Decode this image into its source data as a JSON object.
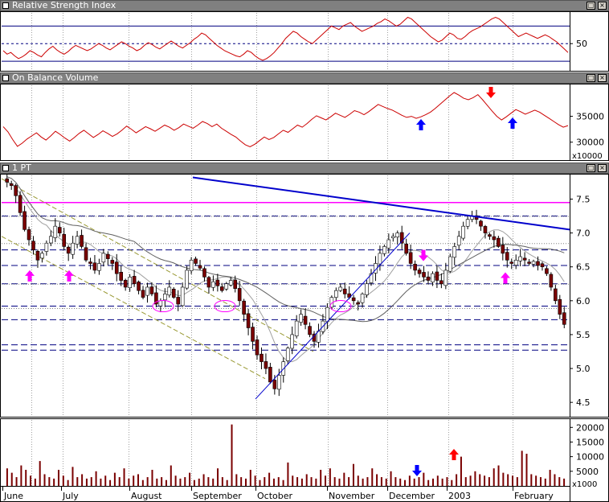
{
  "panes": {
    "rsi": {
      "title": "Relative Strength Index",
      "scale_label": ""
    },
    "obv": {
      "title": "On Balance Volume",
      "scale_label": "x10000"
    },
    "price": {
      "title": "1 PT"
    },
    "volume": {
      "title": "",
      "scale_label": "x1000"
    }
  },
  "window_buttons": {
    "restore": "□",
    "close": "×"
  },
  "colors": {
    "rsi_line": "#cc0000",
    "obv_line": "#cc0000",
    "candle_up": "#ffffff",
    "candle_down": "#7a0000",
    "trendline": "#0000cc",
    "horizontal_line": "#ff00ff",
    "fib_lines": "#000080",
    "channel": "#999933",
    "moving_average": "#808080",
    "volume_bar": "#7a0000",
    "arrow_up_blue": "#0000ff",
    "arrow_down_red": "#ff0000",
    "arrow_magenta": "#ff00ff"
  },
  "chart_data": [
    {
      "id": "rsi",
      "type": "line",
      "title": "Relative Strength Index",
      "y_tick_labels": [
        "50"
      ],
      "reference_lines": [
        30,
        50,
        70
      ],
      "series": [
        {
          "values": [
            42,
            38,
            40,
            36,
            33,
            35,
            38,
            42,
            40,
            37,
            35,
            40,
            44,
            47,
            43,
            40,
            38,
            41,
            45,
            48,
            46,
            44,
            42,
            44,
            47,
            50,
            48,
            45,
            43,
            46,
            49,
            52,
            50,
            47,
            45,
            42,
            44,
            48,
            51,
            49,
            46,
            44,
            47,
            50,
            53,
            50,
            47,
            45,
            48,
            51,
            55,
            58,
            62,
            60,
            56,
            52,
            48,
            45,
            42,
            40,
            38,
            36,
            35,
            38,
            42,
            40,
            36,
            33,
            31,
            33,
            36,
            40,
            45,
            50,
            56,
            60,
            64,
            62,
            58,
            55,
            52,
            50,
            54,
            58,
            62,
            66,
            70,
            68,
            66,
            70,
            72,
            74,
            70,
            67,
            64,
            66,
            68,
            70,
            73,
            75,
            78,
            76,
            73,
            70,
            72,
            76,
            80,
            78,
            74,
            70,
            66,
            62,
            58,
            55,
            52,
            54,
            58,
            62,
            60,
            56,
            55,
            58,
            62,
            65,
            67,
            69,
            72,
            75,
            78,
            80,
            78,
            74,
            70,
            66,
            62,
            58,
            60,
            62,
            60,
            58,
            56,
            58,
            60,
            58,
            55,
            52,
            48,
            44,
            40
          ]
        }
      ]
    },
    {
      "id": "obv",
      "type": "line",
      "title": "On Balance Volume",
      "y_tick_labels": [
        "35000",
        "30000"
      ],
      "ylim": [
        27000,
        41000
      ],
      "series": [
        {
          "values": [
            33000,
            32000,
            30500,
            29200,
            29800,
            30600,
            31200,
            31800,
            31000,
            30400,
            31200,
            32100,
            31500,
            30800,
            30200,
            30900,
            31700,
            32300,
            31600,
            30900,
            31500,
            32200,
            31700,
            31100,
            31600,
            32300,
            33100,
            32500,
            31800,
            32400,
            33000,
            32600,
            32100,
            32700,
            33300,
            32900,
            32300,
            32800,
            33500,
            33100,
            32700,
            33300,
            34000,
            33600,
            33000,
            33500,
            32700,
            32100,
            31500,
            31000,
            30200,
            29500,
            29100,
            29600,
            30300,
            31000,
            30500,
            30900,
            31600,
            32300,
            31900,
            32600,
            33300,
            32900,
            33600,
            34400,
            35100,
            34700,
            34300,
            34900,
            35600,
            35200,
            34800,
            35400,
            36100,
            35800,
            35300,
            35900,
            36600,
            37300,
            36900,
            36500,
            36200,
            35700,
            35200,
            34800,
            35000,
            34600,
            34900,
            35300,
            35800,
            36500,
            37300,
            38100,
            38900,
            39600,
            39100,
            38500,
            38200,
            38600,
            39200,
            38200,
            37100,
            36000,
            35000,
            34300,
            34900,
            35600,
            36300,
            35900,
            35400,
            35800,
            36200,
            35800,
            35200,
            34600,
            34000,
            33400,
            32900,
            33200
          ]
        }
      ],
      "annotations": [
        "blue up arrow (Dec)",
        "red down arrow (Jan)",
        "blue up arrow (Jan/Feb)"
      ]
    },
    {
      "id": "price",
      "type": "candlestick",
      "title": "1 PT",
      "y_tick_labels": [
        "7.5",
        "7.0",
        "6.5",
        "6.0",
        "5.5",
        "5.0",
        "4.5"
      ],
      "ylim": [
        4.3,
        7.85
      ],
      "x_tick_labels": [
        "June",
        "July",
        "August",
        "September",
        "October",
        "November",
        "December",
        "2003",
        "February"
      ],
      "horizontal_levels": {
        "magenta": [
          7.45
        ],
        "dashed": [
          7.25,
          6.75,
          6.52,
          6.25,
          5.92,
          5.72,
          5.35,
          5.27
        ],
        "dotted": [
          7.28,
          6.88,
          6.28,
          5.92
        ]
      },
      "closes": [
        7.75,
        7.7,
        7.55,
        7.3,
        7.05,
        6.9,
        6.75,
        6.6,
        6.7,
        6.85,
        6.95,
        7.1,
        7.0,
        6.8,
        6.7,
        6.85,
        6.95,
        6.8,
        6.6,
        6.55,
        6.45,
        6.55,
        6.7,
        6.62,
        6.55,
        6.4,
        6.3,
        6.2,
        6.35,
        6.25,
        6.15,
        6.05,
        6.2,
        6.1,
        5.95,
        6.0,
        6.1,
        6.2,
        6.05,
        5.95,
        6.2,
        6.45,
        6.6,
        6.55,
        6.48,
        6.35,
        6.2,
        6.28,
        6.22,
        6.15,
        6.25,
        6.3,
        6.18,
        6.0,
        5.8,
        5.6,
        5.4,
        5.2,
        5.1,
        5.0,
        4.8,
        4.7,
        4.9,
        5.1,
        5.3,
        5.5,
        5.7,
        5.8,
        5.65,
        5.5,
        5.4,
        5.55,
        5.7,
        5.9,
        6.05,
        6.15,
        6.2,
        6.1,
        6.05,
        6.0,
        5.95,
        6.1,
        6.25,
        6.4,
        6.55,
        6.7,
        6.8,
        6.9,
        6.95,
        7.0,
        6.85,
        6.7,
        6.55,
        6.45,
        6.4,
        6.35,
        6.3,
        6.4,
        6.3,
        6.25,
        6.45,
        6.65,
        6.8,
        6.95,
        7.1,
        7.2,
        7.25,
        7.2,
        7.1,
        7.0,
        6.95,
        6.9,
        6.8,
        6.7,
        6.6,
        6.55,
        6.6,
        6.65,
        6.6,
        6.55,
        6.58,
        6.52,
        6.5,
        6.4,
        6.2,
        6.0,
        5.8,
        5.65
      ]
    },
    {
      "id": "volume",
      "type": "bar",
      "y_tick_labels": [
        "20000",
        "15000",
        "10000",
        "5000"
      ],
      "ylim": [
        0,
        22000
      ],
      "values": [
        6000,
        4500,
        3000,
        7000,
        5500,
        3500,
        2500,
        8500,
        4000,
        3000,
        2500,
        5500,
        3500,
        2000,
        6500,
        3000,
        4000,
        2500,
        3000,
        5000,
        2500,
        3500,
        2000,
        4500,
        3000,
        6000,
        2500,
        3500,
        4000,
        2000,
        3000,
        5500,
        2500,
        3000,
        2000,
        7000,
        3500,
        2500,
        3000,
        4500,
        2000,
        2500,
        4000,
        3000,
        2500,
        6000,
        3000,
        2000,
        21000,
        4000,
        3000,
        2500,
        5500,
        3500,
        2000,
        3000,
        4500,
        2500,
        3000,
        2000,
        8000,
        3500,
        3000,
        2500,
        4000,
        3000,
        2500,
        5500,
        3500,
        6000,
        3000,
        2500,
        4500,
        3000,
        7500,
        3500,
        2500,
        3000,
        6000,
        4000,
        3000,
        2500,
        5000,
        3000,
        2500,
        2000,
        3500,
        2500,
        3000,
        4500,
        2000,
        2500,
        3500,
        2500,
        3000,
        2000,
        4000,
        10000,
        3000,
        3500,
        5000,
        4000,
        3500,
        3000,
        6000,
        7000,
        4500,
        4000,
        3500,
        3000,
        12000,
        11000,
        4000,
        3500,
        3000,
        2500,
        5500,
        4000,
        3000,
        2500
      ],
      "annotations": [
        "blue down arrow (December)",
        "red up arrow (2003)"
      ]
    }
  ]
}
